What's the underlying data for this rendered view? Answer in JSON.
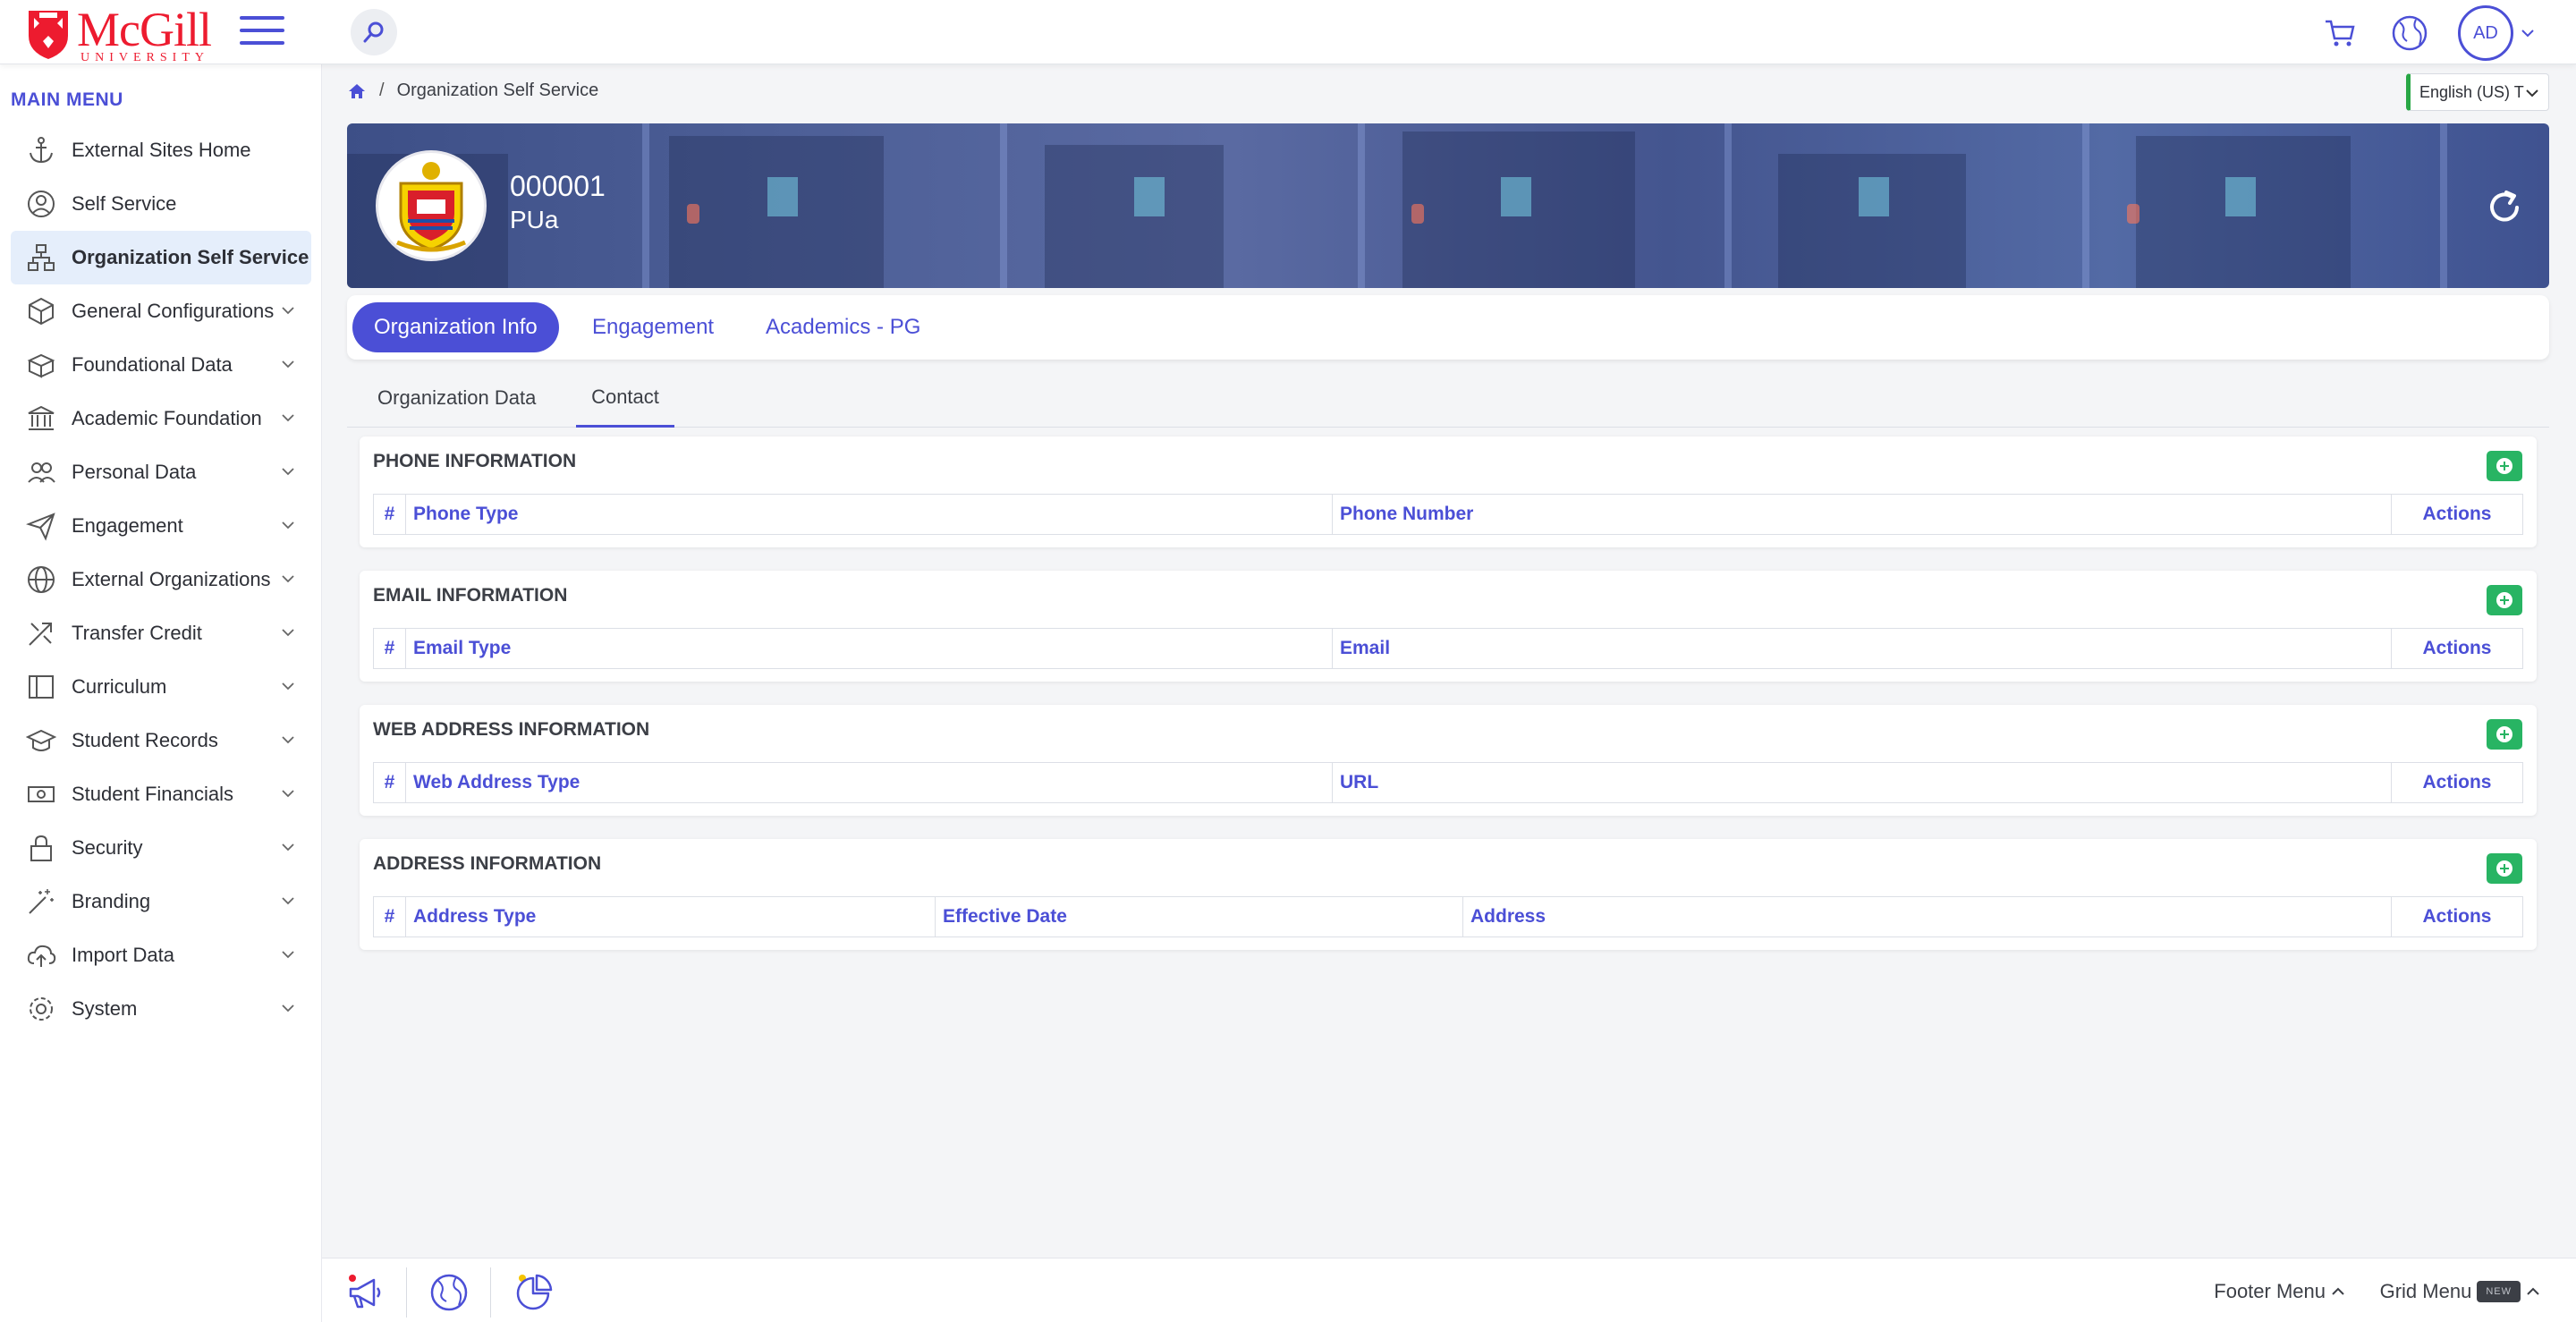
{
  "brand": {
    "name": "McGill",
    "sub": "UNIVERSITY",
    "color": "#ed1b2f"
  },
  "accent": "#4b4fd6",
  "topbar": {
    "icons": [
      "hamburger-icon",
      "search-icon",
      "cart-icon",
      "globe-icon"
    ],
    "avatar": "AD"
  },
  "sidebar": {
    "title": "MAIN MENU",
    "items": [
      {
        "label": "External Sites Home",
        "icon": "anchor-icon"
      },
      {
        "label": "Self Service",
        "icon": "user-icon"
      },
      {
        "label": "Organization Self Service",
        "icon": "org-chart-icon",
        "active": true
      },
      {
        "label": "General Configurations",
        "icon": "cube-icon"
      },
      {
        "label": "Foundational Data",
        "icon": "boxes-icon"
      },
      {
        "label": "Academic Foundation",
        "icon": "institution-icon"
      },
      {
        "label": "Personal Data",
        "icon": "people-icon"
      },
      {
        "label": "Engagement",
        "icon": "send-icon"
      },
      {
        "label": "External Organizations",
        "icon": "globe-icon"
      },
      {
        "label": "Transfer Credit",
        "icon": "transfer-icon"
      },
      {
        "label": "Curriculum",
        "icon": "book-icon"
      },
      {
        "label": "Student Records",
        "icon": "graduation-cap-icon"
      },
      {
        "label": "Student Financials",
        "icon": "money-icon"
      },
      {
        "label": "Security",
        "icon": "lock-icon"
      },
      {
        "label": "Branding",
        "icon": "magic-wand-icon"
      },
      {
        "label": "Import Data",
        "icon": "cloud-upload-icon"
      },
      {
        "label": "System",
        "icon": "gear-icon"
      }
    ]
  },
  "breadcrumb": {
    "home_icon": "home-icon",
    "separator": "/",
    "current": "Organization Self Service"
  },
  "language": "English (US) T",
  "banner": {
    "code": "000001",
    "name": "PUa"
  },
  "tabs": [
    {
      "label": "Organization Info",
      "active": true
    },
    {
      "label": "Engagement"
    },
    {
      "label": "Academics - PG"
    }
  ],
  "subtabs": [
    {
      "label": "Organization Data"
    },
    {
      "label": "Contact",
      "active": true
    }
  ],
  "sections": [
    {
      "title": "PHONE INFORMATION",
      "columns": [
        "#",
        "Phone Type",
        "Phone Number",
        "Actions"
      ]
    },
    {
      "title": "EMAIL INFORMATION",
      "columns": [
        "#",
        "Email Type",
        "Email",
        "Actions"
      ]
    },
    {
      "title": "WEB ADDRESS INFORMATION",
      "columns": [
        "#",
        "Web Address Type",
        "URL",
        "Actions"
      ]
    },
    {
      "title": "ADDRESS INFORMATION",
      "columns": [
        "#",
        "Address Type",
        "Effective Date",
        "Address",
        "Actions"
      ]
    }
  ],
  "footer": {
    "footer_menu": "Footer Menu",
    "grid_menu": "Grid Menu",
    "new_badge": "NEW"
  }
}
